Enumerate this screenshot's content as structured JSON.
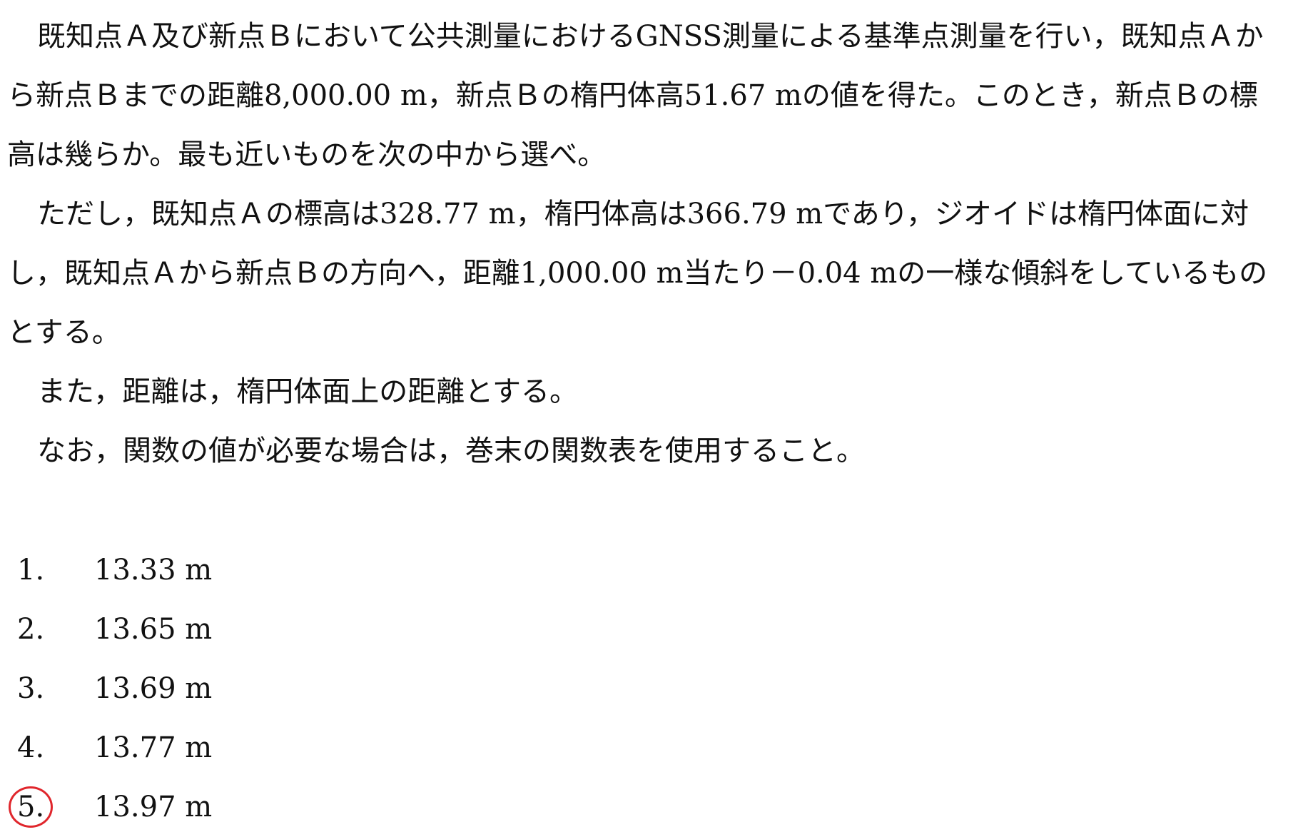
{
  "question": {
    "paragraphs": [
      "既知点Ａ及び新点Ｂにおいて公共測量におけるGNSS測量による基準点測量を行い，既知点Ａから新点Ｂまでの距離8,000.00 m，新点Ｂの楕円体高51.67 mの値を得た。このとき，新点Ｂの標高は幾らか。最も近いものを次の中から選べ。",
      "ただし，既知点Ａの標高は328.77 m，楕円体高は366.79 mであり，ジオイドは楕円体面に対し，既知点Ａから新点Ｂの方向へ，距離1,000.00 m当たり－0.04 mの一様な傾斜をしているものとする。",
      "また，距離は，楕円体面上の距離とする。",
      "なお，関数の値が必要な場合は，巻末の関数表を使用すること。"
    ]
  },
  "choices": [
    {
      "number": "1.",
      "value": "13.33 m",
      "circled": false
    },
    {
      "number": "2.",
      "value": "13.65 m",
      "circled": false
    },
    {
      "number": "3.",
      "value": "13.69 m",
      "circled": false
    },
    {
      "number": "4.",
      "value": "13.77 m",
      "circled": false
    },
    {
      "number": "5.",
      "value": "13.97 m",
      "circled": true
    }
  ],
  "colors": {
    "text": "#111111",
    "answer_circle": "#e0262c"
  }
}
